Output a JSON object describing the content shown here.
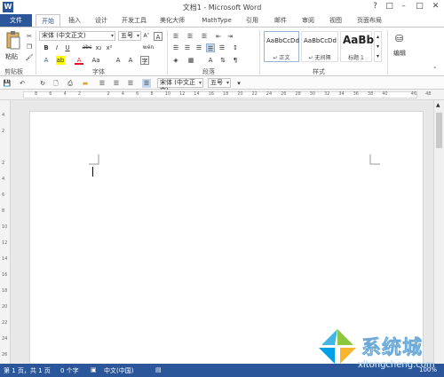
{
  "window": {
    "title": "文档1 - Microsoft Word",
    "controls": [
      "?",
      "□",
      "–",
      "□",
      "✕"
    ]
  },
  "tabs": [
    "文件",
    "开始",
    "插入",
    "设计",
    "开发工具",
    "美化大师",
    "MathType",
    "引用",
    "邮件",
    "审阅",
    "视图",
    "页面布局"
  ],
  "ribbon": {
    "paste_label": "粘贴",
    "clipboard_label": "剪贴板",
    "font_label": "字体",
    "paragraph_label": "段落",
    "styles_label": "样式",
    "edit_label": "编辑",
    "font_name": "宋体 (中文正文)",
    "font_size": "五号",
    "wen_char": "wén",
    "a_char": "A",
    "bold": "B",
    "italic": "I",
    "underline": "U",
    "strike": "abc",
    "subscript": "x₂",
    "superscript": "x²",
    "styles": [
      {
        "sample": "AaBbCcDd",
        "name": "↵ 正文"
      },
      {
        "sample": "AaBbCcDd",
        "name": "↵ 无间隔"
      },
      {
        "sample": "AaBb",
        "name": "标题 1"
      }
    ]
  },
  "qat": {
    "font": "宋体 (中文正文)",
    "size": "五号"
  },
  "ruler": {
    "numbers": [
      "8",
      "6",
      "4",
      "2",
      "",
      "2",
      "4",
      "6",
      "8",
      "10",
      "12",
      "14",
      "16",
      "18",
      "20",
      "22",
      "24",
      "26",
      "28",
      "30",
      "32",
      "34",
      "36",
      "38",
      "40",
      "",
      "46",
      "48"
    ]
  },
  "vruler": {
    "numbers": [
      "4",
      "2",
      "",
      "2",
      "4",
      "6",
      "8",
      "10",
      "12",
      "14",
      "16",
      "18",
      "20",
      "22",
      "24",
      "26"
    ]
  },
  "status": {
    "page": "第 1 页，共 1 页",
    "words": "0 个字",
    "lang": "中文(中国)",
    "zoom": "100%"
  },
  "watermark": {
    "text": "系统城",
    "url": "xitongcheng.com"
  },
  "colors": {
    "accent": "#2b579a",
    "highlight": "#ffff00",
    "font_red": "#e81123"
  }
}
